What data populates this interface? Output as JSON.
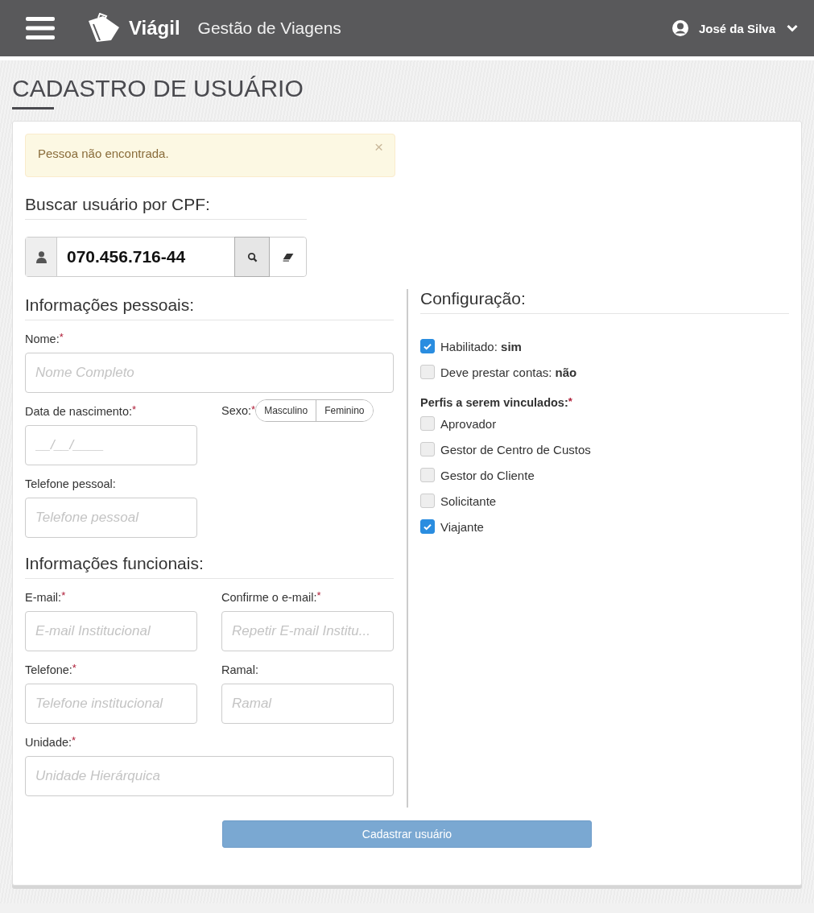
{
  "header": {
    "brand": "Viágil",
    "subtitle": "Gestão de Viagens",
    "user": "José da Silva"
  },
  "page_title": "CADASTRO DE USUÁRIO",
  "alert": {
    "message": "Pessoa não encontrada.",
    "close": "×"
  },
  "search": {
    "heading": "Buscar usuário por CPF:",
    "value": "070.456.716-44"
  },
  "personal": {
    "heading": "Informações pessoais:",
    "rows": [
      [
        {
          "kind": "wide",
          "label": "Nome:",
          "mark": "*",
          "placeholder": "Nome Completo"
        }
      ],
      [
        {
          "kind": "input",
          "label": "Data de nascimento:",
          "mark": "*",
          "placeholder": "__/__/____"
        },
        {
          "kind": "toggle",
          "label": "Sexo:",
          "mark": "*",
          "options": [
            {
              "label": "Masculino",
              "selected": false
            },
            {
              "label": "Feminino",
              "selected": false
            }
          ]
        }
      ],
      [
        {
          "kind": "input",
          "label": "Telefone pessoal:",
          "placeholder": "Telefone pessoal"
        }
      ]
    ]
  },
  "functional": {
    "heading": "Informações funcionais:",
    "rows": [
      [
        {
          "kind": "input",
          "label": "E-mail:",
          "mark": "*",
          "placeholder": "E-mail Institucional"
        },
        {
          "kind": "input",
          "label": "Confirme o e-mail:",
          "mark": "*",
          "placeholder": "Repetir E-mail Institu..."
        }
      ],
      [
        {
          "kind": "input",
          "label": "Telefone:",
          "mark": "*",
          "placeholder": "Telefone institucional"
        },
        {
          "kind": "input",
          "label": "Ramal:",
          "placeholder": "Ramal"
        }
      ],
      [
        {
          "kind": "wide",
          "label": "Unidade:",
          "mark": "*",
          "placeholder": "Unidade Hierárquica"
        }
      ]
    ]
  },
  "configuration": {
    "heading": "Configuração:",
    "settings": [
      {
        "label": "Habilitado: **sim**",
        "checked": true
      },
      {
        "label": "Deve prestar contas: **não**",
        "checked": false
      }
    ],
    "profiles_label": "Perfis a serem vinculados:",
    "profiles_mark": "*",
    "profiles": [
      {
        "label": "Aprovador",
        "checked": false
      },
      {
        "label": "Gestor de Centro de Custos",
        "checked": false
      },
      {
        "label": "Gestor do Cliente",
        "checked": false
      },
      {
        "label": "Solicitante",
        "checked": false
      },
      {
        "label": "Viajante",
        "checked": true
      }
    ]
  },
  "submit": {
    "label": "Cadastrar usuário",
    "disabled": true
  }
}
